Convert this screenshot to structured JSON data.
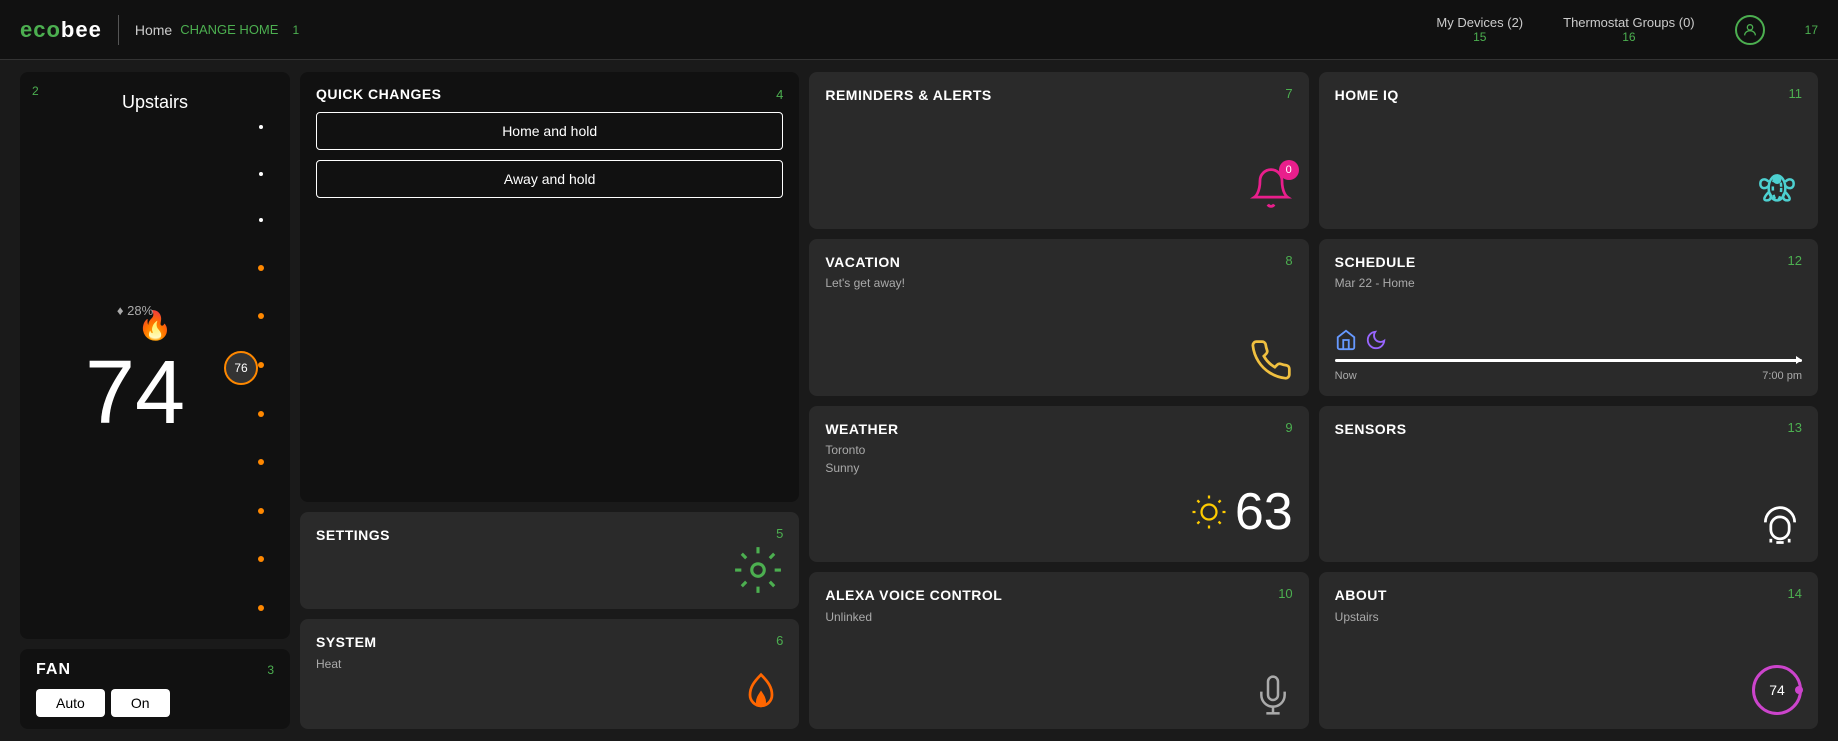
{
  "header": {
    "logo": "ecobee",
    "divider": "|",
    "home_label": "Home",
    "change_home": "CHANGE HOME",
    "home_number": "1",
    "my_devices": "My Devices",
    "my_devices_count": "(2)",
    "my_devices_number": "15",
    "thermostat_groups": "Thermostat Groups",
    "thermostat_groups_count": "(0)",
    "thermostat_groups_number": "16",
    "user_number": "17"
  },
  "thermostat": {
    "number": "2",
    "name": "Upstairs",
    "humidity": "♦ 28%",
    "temp": "74",
    "set_temp": "76",
    "flame_icon": "🔥"
  },
  "fan": {
    "number": "3",
    "label": "FAN",
    "btn_auto": "Auto",
    "btn_on": "On"
  },
  "quick_changes": {
    "number": "4",
    "title": "QUICK CHANGES",
    "btn_home": "Home and hold",
    "btn_away": "Away and hold"
  },
  "settings": {
    "number": "5",
    "title": "SETTINGS"
  },
  "system": {
    "number": "6",
    "title": "SYSTEM",
    "subtitle": "Heat"
  },
  "reminders": {
    "number": "7",
    "title": "REMINDERS & ALERTS",
    "badge": "0"
  },
  "vacation": {
    "number": "8",
    "title": "VACATION",
    "subtitle": "Let's get away!"
  },
  "weather": {
    "number": "9",
    "title": "WEATHER",
    "city": "Toronto",
    "condition": "Sunny",
    "temp": "63"
  },
  "alexa": {
    "number": "10",
    "title": "ALEXA VOICE CONTROL",
    "subtitle": "Unlinked"
  },
  "home_iq": {
    "number": "11",
    "title": "HOME IQ"
  },
  "schedule": {
    "number": "12",
    "title": "SCHEDULE",
    "date": "Mar 22 - Home",
    "now_label": "Now",
    "end_label": "7:00 pm"
  },
  "sensors": {
    "number": "13",
    "title": "SENSORS"
  },
  "about": {
    "number": "14",
    "title": "ABOUT",
    "subtitle": "Upstairs",
    "temp": "74"
  }
}
